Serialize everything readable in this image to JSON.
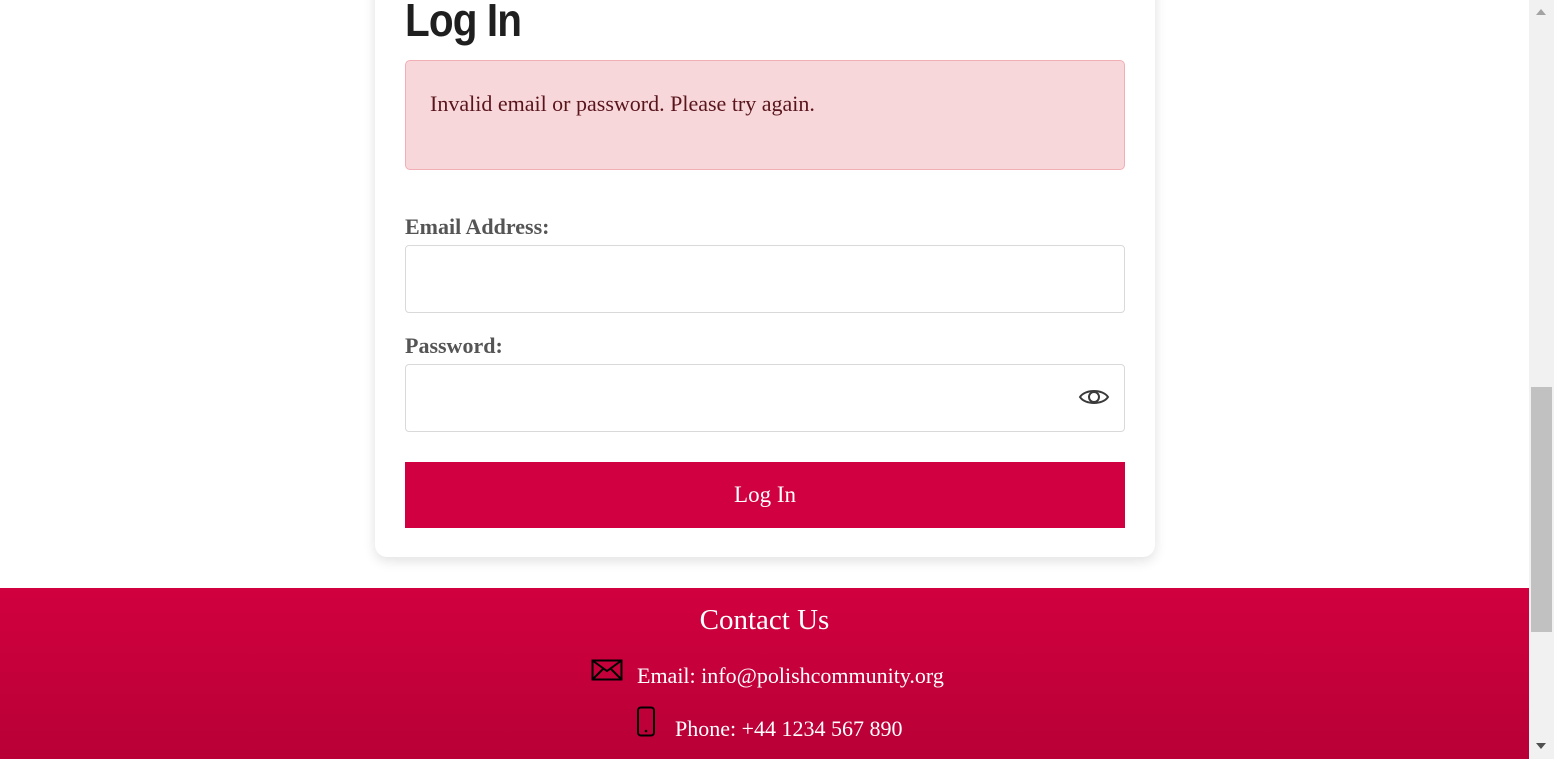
{
  "login": {
    "title": "Log In",
    "error_message": "Invalid email or password. Please try again.",
    "email_label": "Email Address:",
    "email_value": "",
    "password_label": "Password:",
    "password_value": "",
    "password_toggle_icon": "eye-icon",
    "submit_label": "Log In"
  },
  "footer": {
    "title": "Contact Us",
    "email_prefix": "Email:",
    "email_address": "info@polishcommunity.org",
    "email_icon": "envelope-icon",
    "phone_prefix": "Phone:",
    "phone_number": "+44 1234 567 890",
    "phone_icon": "mobile-phone-icon"
  },
  "colors": {
    "accent": "#d10040",
    "alert_background": "#f8d7da",
    "alert_text": "#58151c"
  }
}
